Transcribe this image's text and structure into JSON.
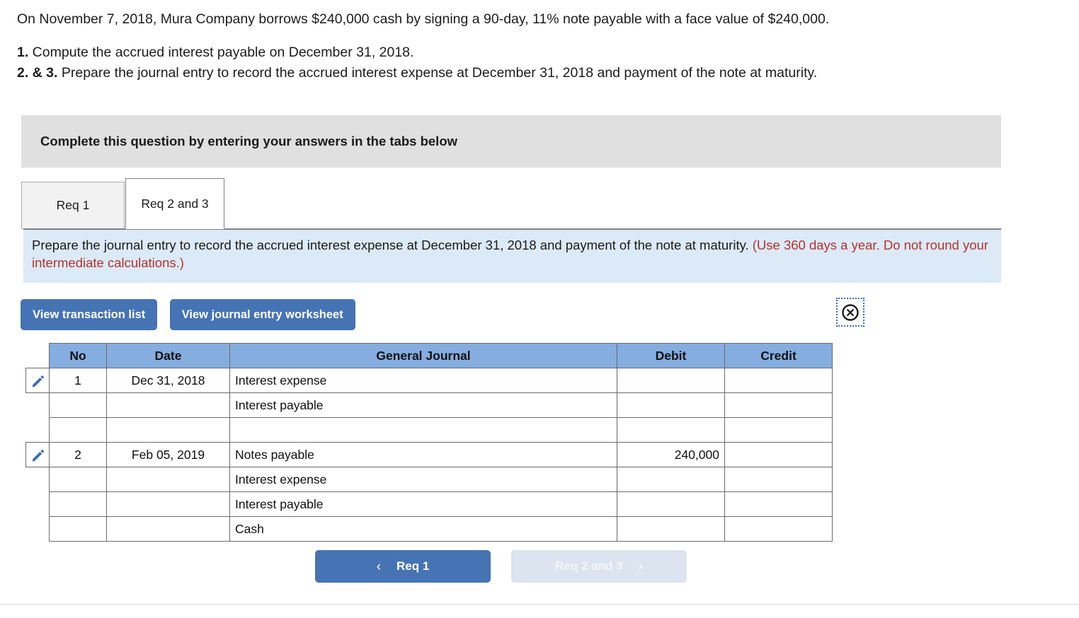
{
  "problem": {
    "statement": "On November 7, 2018, Mura Company borrows $240,000 cash by signing a 90-day, 11% note payable with a face value of $240,000.",
    "requirements": [
      {
        "num": "1.",
        "text": " Compute the accrued interest payable on December 31, 2018."
      },
      {
        "num": "2. & 3.",
        "text": " Prepare the journal entry to record the accrued interest expense at December 31, 2018 and payment of the note at maturity."
      }
    ]
  },
  "banner": {
    "text": "Complete this question by entering your answers in the tabs below"
  },
  "tabs": [
    {
      "label": "Req 1",
      "active": false
    },
    {
      "label": "Req 2 and 3",
      "active": true
    }
  ],
  "info": {
    "main": "Prepare the journal entry to record the accrued interest expense at December 31, 2018 and payment of the note at maturity. ",
    "note": "(Use 360 days a year. Do not round your intermediate calculations.)"
  },
  "actions": {
    "transaction_list": "View transaction list",
    "journal_worksheet": "View journal entry worksheet",
    "close_icon": "close-circle-icon"
  },
  "journal": {
    "columns": [
      "No",
      "Date",
      "General Journal",
      "Debit",
      "Credit"
    ],
    "rows": [
      {
        "pencil": true,
        "no": "1",
        "date": "Dec 31, 2018",
        "account": "Interest expense",
        "debit": "",
        "credit": ""
      },
      {
        "pencil": false,
        "no": "",
        "date": "",
        "account": "Interest payable",
        "debit": "",
        "credit": ""
      },
      {
        "pencil": false,
        "no": "",
        "date": "",
        "account": "",
        "debit": "",
        "credit": ""
      },
      {
        "pencil": true,
        "no": "2",
        "date": "Feb 05, 2019",
        "account": "Notes payable",
        "debit": "240,000",
        "credit": ""
      },
      {
        "pencil": false,
        "no": "",
        "date": "",
        "account": "Interest expense",
        "debit": "",
        "credit": ""
      },
      {
        "pencil": false,
        "no": "",
        "date": "",
        "account": "Interest payable",
        "debit": "",
        "credit": ""
      },
      {
        "pencil": false,
        "no": "",
        "date": "",
        "account": "Cash",
        "debit": "",
        "credit": ""
      }
    ]
  },
  "nav": {
    "prev_label": "Req 1",
    "prev_chevron": "‹",
    "next_label": "Req 2 and 3",
    "next_chevron": "›"
  },
  "colors": {
    "accent_blue": "#4673b3",
    "table_header_blue": "#85ade0",
    "info_panel_blue": "#dceaf7",
    "banner_gray": "#e0e0e0",
    "note_red": "#b5322e",
    "disabled_button": "#dbe4ef"
  }
}
